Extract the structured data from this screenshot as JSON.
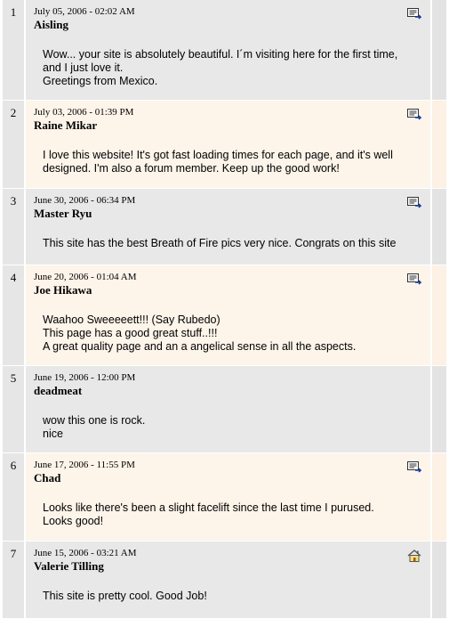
{
  "entries": [
    {
      "num": "1",
      "date": "July 05, 2006 - 02:02 AM",
      "author": "Aisling",
      "message": "Wow... your site is absolutely beautiful. I´m visiting here for the first time,\nand I just love it.\nGreetings from Mexico.",
      "icon": "email-icon"
    },
    {
      "num": "2",
      "date": "July 03, 2006 - 01:39 PM",
      "author": "Raine Mikar",
      "message": "I love this website! It's got fast loading times for each page, and it's well\ndesigned. I'm also a forum member. Keep up the good work!",
      "icon": "email-icon"
    },
    {
      "num": "3",
      "date": "June 30, 2006 - 06:34 PM",
      "author": "Master Ryu",
      "message": "This site has the best Breath of Fire pics very nice. Congrats on this site",
      "icon": "email-icon"
    },
    {
      "num": "4",
      "date": "June 20, 2006 - 01:04 AM",
      "author": "Joe Hikawa",
      "message": "Waahoo Sweeeeett!!! (Say Rubedo)\nThis page has a good great stuff..!!!\nA great quality page and an a angelical sense in all the aspects.",
      "icon": "email-icon"
    },
    {
      "num": "5",
      "date": "June 19, 2006 - 12:00 PM",
      "author": "deadmeat",
      "message": "wow this one is rock.\nnice",
      "icon": ""
    },
    {
      "num": "6",
      "date": "June 17, 2006 - 11:55 PM",
      "author": "Chad",
      "message": "Looks like there's been a slight facelift since the last time I purused.\nLooks good!",
      "icon": "email-icon"
    },
    {
      "num": "7",
      "date": "June 15, 2006 - 03:21 AM",
      "author": "Valerie Tilling",
      "message": "This site is pretty cool. Good Job!",
      "icon": "home-icon"
    }
  ]
}
